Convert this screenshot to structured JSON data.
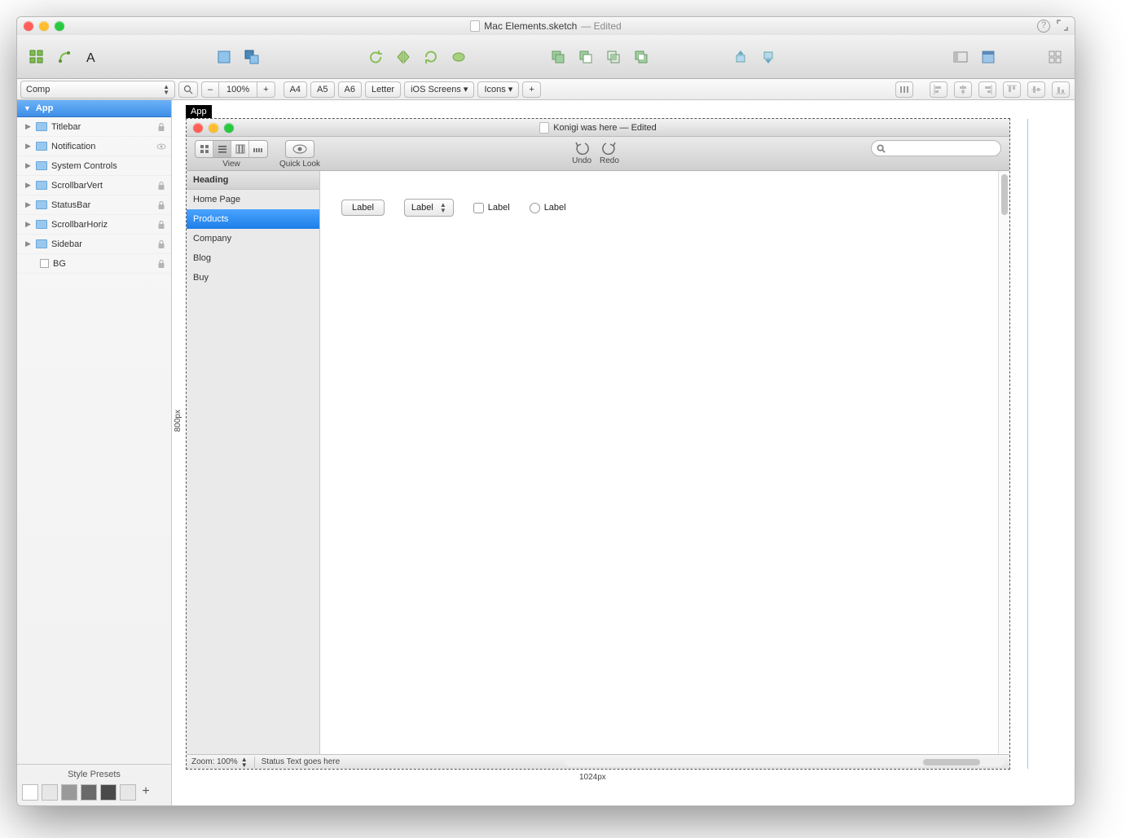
{
  "window": {
    "filename": "Mac Elements.sketch",
    "edited_suffix": " — Edited"
  },
  "secondbar": {
    "pages_selected": "Comp",
    "zoom_value": "100%",
    "presets": {
      "a4": "A4",
      "a5": "A5",
      "a6": "A6",
      "letter": "Letter",
      "ios": "iOS Screens ▾",
      "icons": "Icons ▾",
      "add": "+"
    }
  },
  "layers": {
    "header": "App",
    "items": [
      {
        "label": "Titlebar",
        "icon": "folder",
        "locked": true
      },
      {
        "label": "Notification",
        "icon": "folder",
        "eye": true
      },
      {
        "label": "System Controls",
        "icon": "folder"
      },
      {
        "label": "ScrollbarVert",
        "icon": "folder",
        "locked": true
      },
      {
        "label": "StatusBar",
        "icon": "folder",
        "locked": true
      },
      {
        "label": "ScrollbarHoriz",
        "icon": "folder",
        "locked": true
      },
      {
        "label": "Sidebar",
        "icon": "folder",
        "locked": true
      },
      {
        "label": "BG",
        "icon": "rect",
        "locked": true,
        "indent": true
      }
    ],
    "style_presets_title": "Style Presets",
    "swatches": [
      "#ffffff",
      "#e7e7e7",
      "#9a9a9a",
      "#6a6a6a",
      "#4a4a4a",
      "#e7e7e7"
    ]
  },
  "artboard": {
    "label": "App",
    "width_label": "1024px",
    "height_label": "800px"
  },
  "mock": {
    "title": "Konigi was here — Edited",
    "toolbar": {
      "view": "View",
      "quicklook": "Quick Look",
      "undo": "Undo",
      "redo": "Redo"
    },
    "sidebar": {
      "heading": "Heading",
      "items": [
        "Home Page",
        "Products",
        "Company",
        "Blog",
        "Buy"
      ],
      "selected_index": 1
    },
    "controls": {
      "button_label": "Label",
      "select_label": "Label",
      "checkbox_label": "Label",
      "radio_label": "Label"
    },
    "status": {
      "zoom": "Zoom: 100%",
      "text": "Status Text goes here"
    }
  }
}
